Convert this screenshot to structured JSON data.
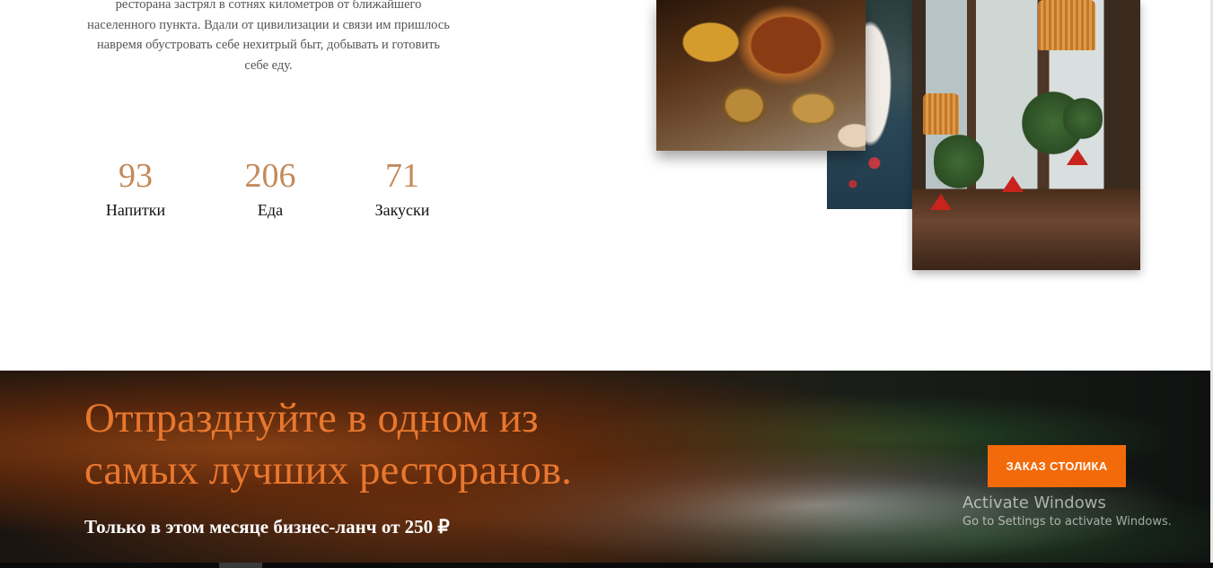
{
  "about": {
    "lines": [
      "ресторана застрял в сотнях километров от ближайшего",
      "населенного пункта. Вдали от цивилизации и связи им пришлось",
      "навремя обустровать себе нехитрый быт, добывать и готовить",
      "себе еду."
    ]
  },
  "stats": [
    {
      "value": "93",
      "label": "Напитки"
    },
    {
      "value": "206",
      "label": "Еда"
    },
    {
      "value": "71",
      "label": "Закуски"
    }
  ],
  "banner": {
    "title_line1": "Отпразднуйте в одном из",
    "title_line2": "самых лучших ресторанов.",
    "subtitle": "Только в этом месяце бизнес-ланч от 250 ₽",
    "button_label": "ЗАКАЗ СТОЛИКА"
  },
  "os_notice": {
    "title": "Activate Windows",
    "subtitle": "Go to Settings to activate Windows."
  },
  "colors": {
    "accent": "#f26a0a",
    "stat_number": "#c38a5c",
    "banner_title": "#e8772e"
  }
}
